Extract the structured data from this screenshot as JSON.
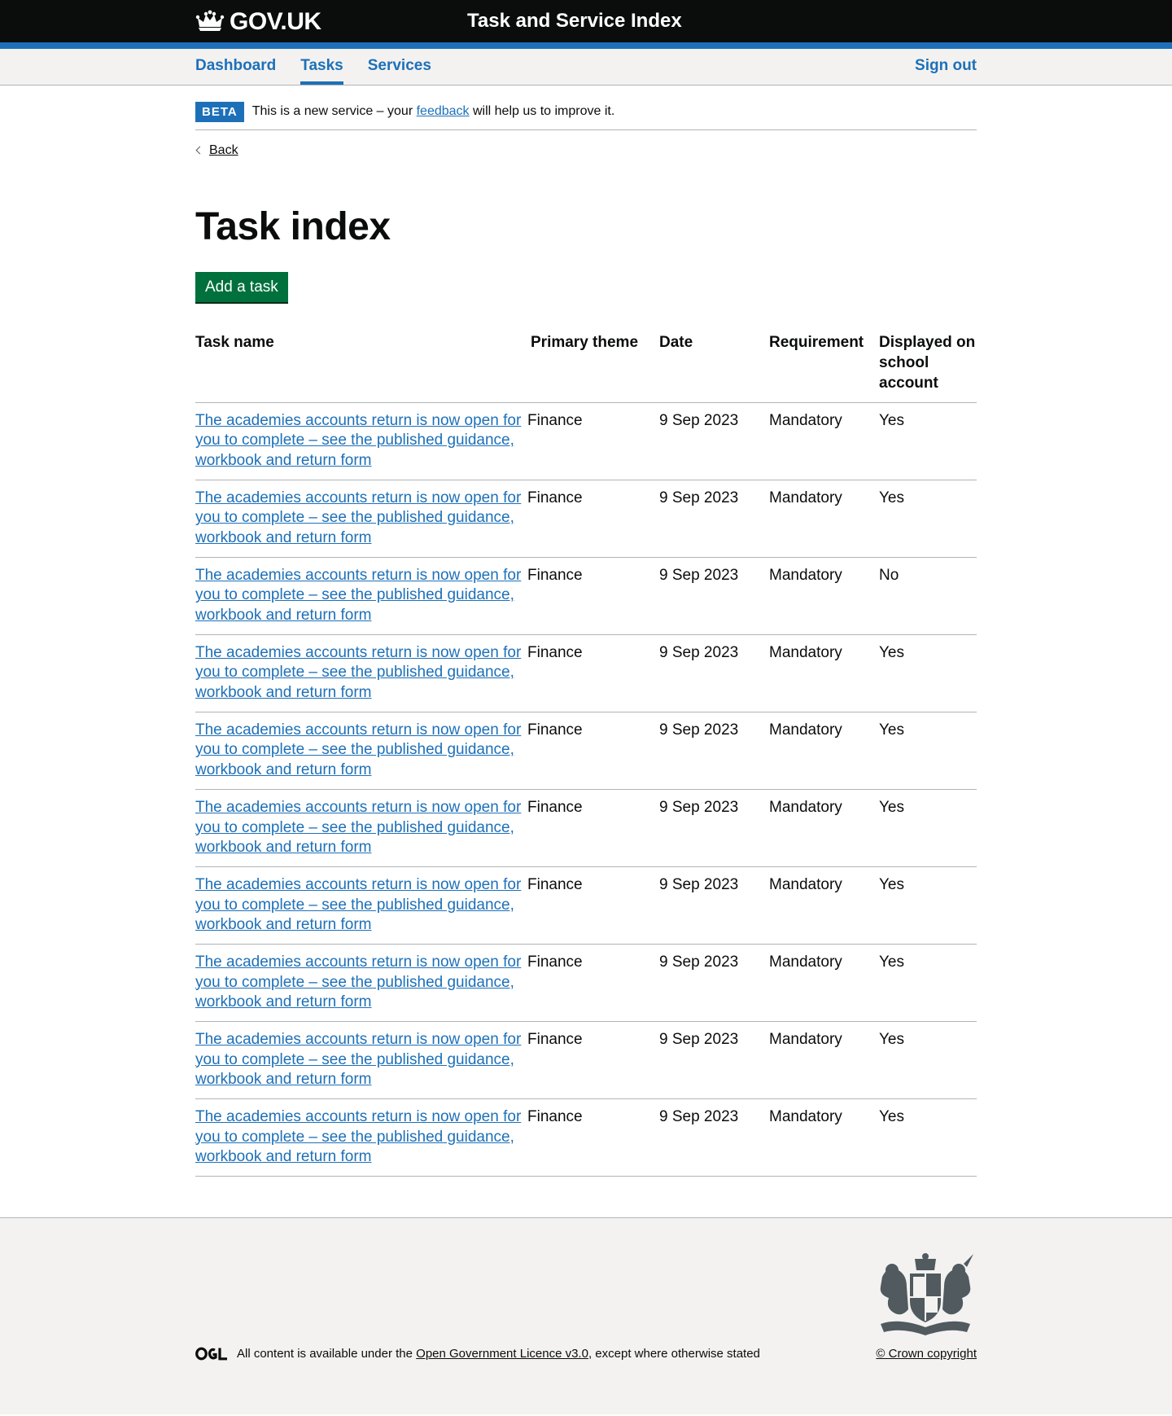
{
  "header": {
    "logo_text": "GOV.UK",
    "service_name": "Task and Service Index"
  },
  "nav": {
    "items": [
      {
        "label": "Dashboard",
        "active": false
      },
      {
        "label": "Tasks",
        "active": true
      },
      {
        "label": "Services",
        "active": false
      }
    ],
    "sign_out": "Sign out"
  },
  "beta": {
    "tag": "BETA",
    "text_before": "This is a new service – your",
    "link": "feedback",
    "text_after": "will help us to improve it."
  },
  "back_link": "Back",
  "page_title": "Task index",
  "add_button": "Add a task",
  "table": {
    "headers": [
      "Task name",
      "Primary theme",
      "Date",
      "Requirement",
      "Displayed on school account"
    ],
    "rows": [
      {
        "name": "The academies accounts return is now open for you to complete – see the published guidance, workbook and return form",
        "theme": "Finance",
        "date": "9 Sep 2023",
        "requirement": "Mandatory",
        "displayed": "Yes"
      },
      {
        "name": "The academies accounts return is now open for you to complete – see the published guidance, workbook and return form",
        "theme": "Finance",
        "date": "9 Sep 2023",
        "requirement": "Mandatory",
        "displayed": "Yes"
      },
      {
        "name": "The academies accounts return is now open for you to complete – see the published guidance, workbook and return form",
        "theme": "Finance",
        "date": "9 Sep 2023",
        "requirement": "Mandatory",
        "displayed": "No"
      },
      {
        "name": "The academies accounts return is now open for you to complete – see the published guidance, workbook and return form",
        "theme": "Finance",
        "date": "9 Sep 2023",
        "requirement": "Mandatory",
        "displayed": "Yes"
      },
      {
        "name": "The academies accounts return is now open for you to complete – see the published guidance, workbook and return form",
        "theme": "Finance",
        "date": "9 Sep 2023",
        "requirement": "Mandatory",
        "displayed": "Yes"
      },
      {
        "name": "The academies accounts return is now open for you to complete – see the published guidance, workbook and return form",
        "theme": "Finance",
        "date": "9 Sep 2023",
        "requirement": "Mandatory",
        "displayed": "Yes"
      },
      {
        "name": "The academies accounts return is now open for you to complete – see the published guidance, workbook and return form",
        "theme": "Finance",
        "date": "9 Sep 2023",
        "requirement": "Mandatory",
        "displayed": "Yes"
      },
      {
        "name": "The academies accounts return is now open for you to complete – see the published guidance, workbook and return form",
        "theme": "Finance",
        "date": "9 Sep 2023",
        "requirement": "Mandatory",
        "displayed": "Yes"
      },
      {
        "name": "The academies accounts return is now open for you to complete – see the published guidance, workbook and return form",
        "theme": "Finance",
        "date": "9 Sep 2023",
        "requirement": "Mandatory",
        "displayed": "Yes"
      },
      {
        "name": "The academies accounts return is now open for you to complete – see the published guidance, workbook and return form",
        "theme": "Finance",
        "date": "9 Sep 2023",
        "requirement": "Mandatory",
        "displayed": "Yes"
      }
    ]
  },
  "footer": {
    "ogl_logo": "OGL",
    "licence_before": "All content is available under the",
    "licence_link": "Open Government Licence v3.0",
    "licence_after": ", except where otherwise stated",
    "copyright": "© Crown copyright"
  },
  "colors": {
    "header_bg": "#0b0c0c",
    "accent_blue": "#1d70b8",
    "button_green": "#00703c",
    "footer_bg": "#f3f2f1"
  },
  "icons": [
    "crown-icon",
    "chevron-left-icon",
    "royal-crest-icon"
  ]
}
